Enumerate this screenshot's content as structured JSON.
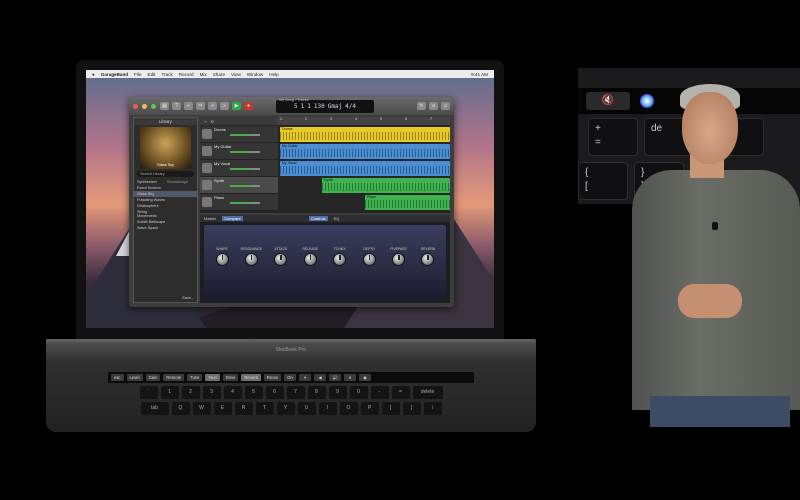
{
  "menubar": {
    "apple": "",
    "app": "GarageBand",
    "items": [
      "File",
      "Edit",
      "Track",
      "Record",
      "Mix",
      "Share",
      "View",
      "Window",
      "Help"
    ],
    "status": [
      "9:41 AM"
    ]
  },
  "toolbar": {
    "window_title": "My Song - Tracks",
    "lcd": [
      "5",
      "1",
      "1",
      "130",
      "Gmaj",
      "4/4"
    ]
  },
  "library": {
    "title": "Library",
    "patch_name": "Glass Sky",
    "search_placeholder": "Search Library",
    "rows": [
      {
        "col1": "Synthesizer",
        "col2": "Soundscape"
      },
      {
        "col1": "Event Horizon",
        "col2": ""
      },
      {
        "col1": "Glass Sky",
        "col2": ""
      },
      {
        "col1": "Pulsating Waves",
        "col2": ""
      },
      {
        "col1": "Stratosphere",
        "col2": ""
      },
      {
        "col1": "String Movements",
        "col2": ""
      },
      {
        "col1": "Subtle Bellscape",
        "col2": ""
      },
      {
        "col1": "Wave Space",
        "col2": ""
      }
    ],
    "save_label": "Save..."
  },
  "tracks": {
    "header": [
      "+",
      "⟲"
    ],
    "list": [
      {
        "name": "Drums",
        "region": "Drums",
        "color": "#e7c92a"
      },
      {
        "name": "My Guitar",
        "region": "My Guitar",
        "color": "#4a8fd6"
      },
      {
        "name": "My Vocal",
        "region": "My Vocal",
        "color": "#4a8fd6"
      },
      {
        "name": "Synth",
        "region": "Synth",
        "color": "#3fb34f"
      },
      {
        "name": "Piano",
        "region": "Piano",
        "color": "#3fb34f"
      }
    ],
    "ruler": [
      "1",
      "2",
      "3",
      "4",
      "5",
      "6",
      "7"
    ]
  },
  "smart_controls": {
    "tabs": [
      "Master",
      "Compare",
      "Controls",
      "EQ"
    ],
    "knobs": [
      "SHAPE",
      "RESONANCE",
      "ATTACK",
      "RELEASE",
      "TO MIX",
      "DEPTH",
      "FIVEPASS",
      "REVERB"
    ]
  },
  "laptop": {
    "brand": "MacBook Pro",
    "touchbar": [
      "esc",
      "Level",
      "Gain",
      "Remote",
      "Tune",
      "Feel",
      "Drive",
      "Reverb",
      "Room",
      "On",
      "☀",
      "◀",
      "🔊",
      "✕",
      "◉"
    ],
    "keyrows": [
      [
        "`",
        "1",
        "2",
        "3",
        "4",
        "5",
        "6",
        "7",
        "8",
        "9",
        "0",
        "-",
        "=",
        "delete"
      ],
      [
        "tab",
        "Q",
        "W",
        "E",
        "R",
        "T",
        "Y",
        "U",
        "I",
        "O",
        "P",
        "[",
        "]",
        "\\"
      ]
    ]
  },
  "keyboard_closeup": {
    "touch_keys": [
      "🔇",
      ""
    ],
    "big_keys": [
      {
        "top": "+",
        "bottom": "="
      },
      {
        "top": "de",
        "bottom": ""
      },
      {
        "top": "{",
        "bottom": "["
      },
      {
        "top": "}",
        "bottom": "]"
      }
    ]
  }
}
